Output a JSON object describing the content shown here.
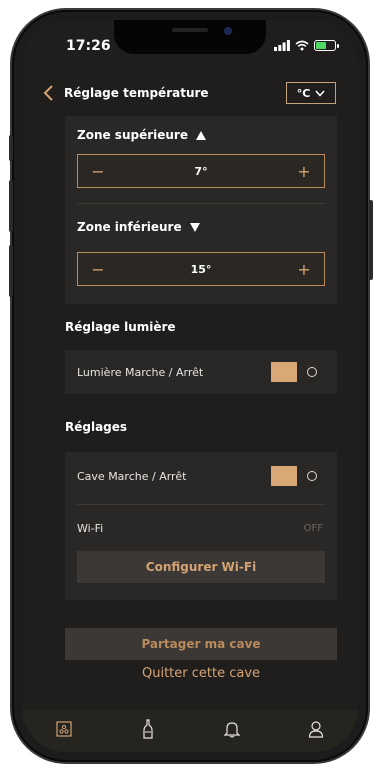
{
  "status_bar": {
    "time": "17:26"
  },
  "header": {
    "title": "Réglage température",
    "unit": "°C"
  },
  "temperature": {
    "upper_zone_label": "Zone supérieure",
    "upper_value": "7°",
    "lower_zone_label": "Zone inférieure",
    "lower_value": "15°",
    "minus": "−",
    "plus": "+"
  },
  "light": {
    "section_title": "Réglage lumière",
    "toggle_label": "Lumière Marche / Arrêt"
  },
  "settings": {
    "section_title": "Réglages",
    "cellar_toggle_label": "Cave Marche / Arrêt",
    "wifi_label": "Wi-Fi",
    "wifi_status": "OFF",
    "configure_wifi": "Configurer Wi-Fi"
  },
  "actions": {
    "share": "Partager ma cave",
    "leave": "Quitter cette cave"
  },
  "colors": {
    "accent": "#d4a373",
    "background": "#1f1e1d",
    "panel": "#2a2826"
  },
  "tabs": [
    {
      "icon": "cellar-icon",
      "active": true
    },
    {
      "icon": "bottle-icon",
      "active": false
    },
    {
      "icon": "bell-icon",
      "active": false
    },
    {
      "icon": "profile-icon",
      "active": false
    }
  ]
}
